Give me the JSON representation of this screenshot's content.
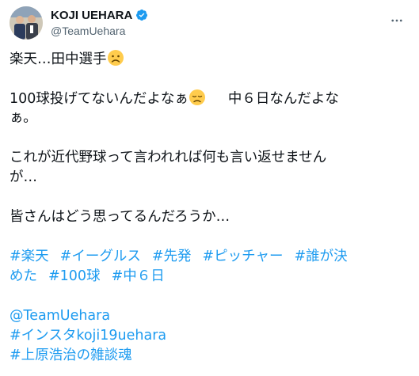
{
  "user": {
    "display_name": "KOJI UEHARA",
    "handle": "@TeamUehara",
    "verified": true
  },
  "tweet": {
    "line1": "楽天…田中選手",
    "line2a": "100球投げてないんだよなぁ",
    "line2b": "中６日なんだよな",
    "line3": "ぁ。",
    "line4": "これが近代野球って言われれば何も言い返せません",
    "line5": "が…",
    "line6": "皆さんはどう思ってるんだろうか…",
    "hashtags_row1": [
      "#楽天",
      "#イーグルス",
      "#先発",
      "#ピッチャー",
      "#誰が決"
    ],
    "hashtags_row2": [
      "めた",
      "#100球",
      "#中６日"
    ],
    "mention": "@TeamUehara",
    "insta_tag": "#インスタkoji19uehara",
    "last_tag": "#上原浩治の雑談魂"
  },
  "colors": {
    "link": "#1d9bf0",
    "text": "#0f1419",
    "secondary": "#536471",
    "verified": "#1d9bf0"
  },
  "icons": {
    "verified": "verified-badge-icon",
    "more": "more-horizontal-icon",
    "sad_face": "slightly-frowning-face-emoji",
    "disappointed_face": "disappointed-face-emoji"
  }
}
